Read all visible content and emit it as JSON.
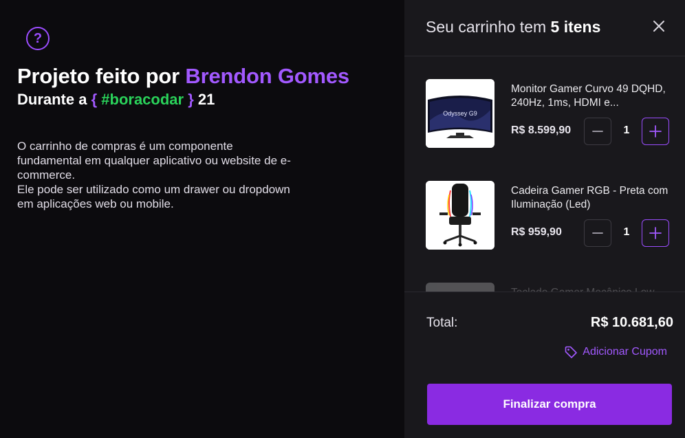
{
  "intro": {
    "headline_prefix": "Projeto feito por ",
    "author": "Brendon Gomes",
    "subline_prefix": "Durante a ",
    "brace_open": "{",
    "hashtag": " #boracodar ",
    "brace_close": "}",
    "edition": " 21",
    "description_1": "O carrinho de compras é um componente fundamental em qualquer aplicativo ou website de e-commerce.",
    "description_2": "Ele pode ser utilizado como um drawer ou dropdown em aplicações web ou mobile.",
    "help_icon": "help-circle-icon"
  },
  "cart": {
    "title_prefix": "Seu carrinho tem ",
    "count_text": "5 itens",
    "close_icon": "close-icon",
    "items": [
      {
        "name": "Monitor Gamer Curvo 49 DQHD, 240Hz, 1ms, HDMI e...",
        "price": "R$ 8.599,90",
        "qty": "1",
        "thumb_text": "Odyssey G9"
      },
      {
        "name": "Cadeira Gamer RGB - Preta com Iluminação (Led)",
        "price": "R$ 959,90",
        "qty": "1"
      },
      {
        "name": "Teclado Gamer Mecânico Low",
        "price": "",
        "qty": ""
      }
    ],
    "total_label": "Total:",
    "total_value": "R$ 10.681,60",
    "coupon_label": "Adicionar Cupom",
    "checkout_label": "Finalizar compra"
  },
  "colors": {
    "accent": "#a259ff",
    "button": "#8a2be2",
    "hashtag": "#2ad25a",
    "background": "#0c0b0e",
    "drawer": "#19181c"
  }
}
